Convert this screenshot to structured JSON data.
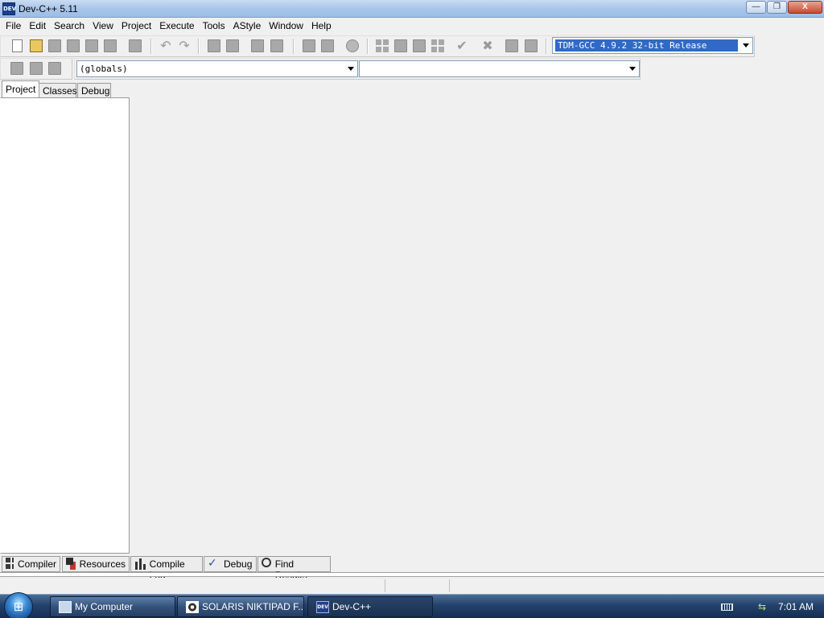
{
  "window": {
    "title": "Dev-C++ 5.11",
    "app_icon_text": "DEV",
    "minimize": "—",
    "restore": "❐",
    "close": "X"
  },
  "menu": [
    "File",
    "Edit",
    "Search",
    "View",
    "Project",
    "Execute",
    "Tools",
    "AStyle",
    "Window",
    "Help"
  ],
  "toolbar": {
    "compiler_select": "TDM-GCC 4.9.2 32-bit Release"
  },
  "navbar": {
    "scope_select": "(globals)",
    "member_select": ""
  },
  "left_tabs": [
    "Project",
    "Classes",
    "Debug"
  ],
  "bottom_tabs": [
    "Compiler",
    "Resources",
    "Compile Log",
    "Debug",
    "Find Results"
  ],
  "taskbar": {
    "buttons": [
      "My Computer",
      "SOLARIS NIKTIPAD F...",
      "Dev-C++"
    ],
    "clock": "7:01 AM"
  }
}
